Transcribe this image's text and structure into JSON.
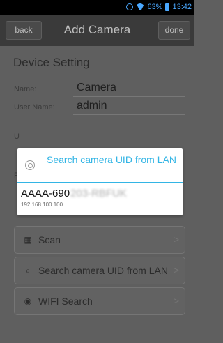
{
  "status_bar": {
    "battery": "63%",
    "time": "13:42"
  },
  "header": {
    "back_label": "back",
    "title": "Add Camera",
    "done_label": "done"
  },
  "form": {
    "section_title": "Device Setting",
    "name_label": "Name:",
    "name_value": "Camera",
    "user_label": "User Name:",
    "user_value": "admin",
    "pw_label_partial": "U",
    "pw2_label_partial": "P"
  },
  "buttons": {
    "scan": "Scan",
    "search": "Search camera UID from LAN",
    "wifi": "WIFI Search"
  },
  "dialog": {
    "title": "Search camera UID from LAN",
    "results": [
      {
        "uid_prefix": "AAAA-690",
        "uid_obscured": "203-RBFUK",
        "ip": "192.168.100.100"
      }
    ]
  },
  "colors": {
    "accent": "#33b5e5",
    "status_icons": "#4aa8ff"
  },
  "icons": [
    "alarm-icon",
    "wifi-icon",
    "battery-icon",
    "scan-icon",
    "search-icon",
    "wifi-search-icon",
    "chevron-right-icon",
    "radar-icon"
  ]
}
